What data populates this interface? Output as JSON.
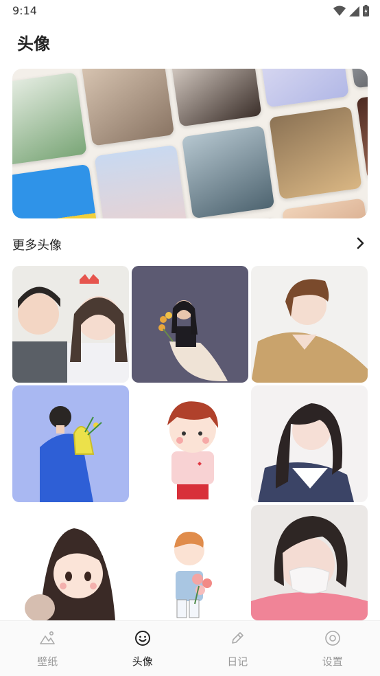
{
  "status_bar": {
    "time": "9:14"
  },
  "page": {
    "title": "头像"
  },
  "section": {
    "title": "更多头像"
  },
  "bottom_nav": {
    "items": [
      {
        "label": "壁纸",
        "icon": "wallpaper-icon",
        "active": false
      },
      {
        "label": "头像",
        "icon": "smiley-icon",
        "active": true
      },
      {
        "label": "日记",
        "icon": "pencil-icon",
        "active": false
      },
      {
        "label": "设置",
        "icon": "settings-icon",
        "active": false
      }
    ]
  },
  "colors": {
    "active_text": "#222222",
    "inactive_text": "#9a9a9a",
    "cell_purple": "#5c5a72",
    "cell_blue": "#a9b8f2"
  }
}
